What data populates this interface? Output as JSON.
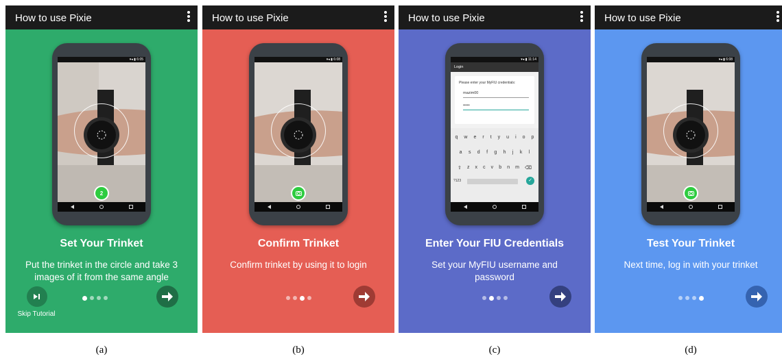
{
  "app_title": "How to use Pixie",
  "panels": [
    {
      "caption": "(a)",
      "bg_color": "#2eab6b",
      "heading": "Set Your Trinket",
      "description": "Put the trinket in the circle and take 3 images of it from the same angle",
      "capture_badge": "2",
      "active_dot": 1,
      "skip_label": "Skip Tutorial",
      "next_color": "#1f6e46"
    },
    {
      "caption": "(b)",
      "bg_color": "#e55e54",
      "heading": "Confirm Trinket",
      "description": "Confirm trinket by using it to login",
      "active_dot": 2,
      "next_color": "#9f3b34"
    },
    {
      "caption": "(c)",
      "bg_color": "#5c6bc8",
      "heading": "Enter Your FIU Credentials",
      "description": "Set your MyFIU username and password",
      "active_dot": 3,
      "next_color": "#34407f",
      "login_screen": {
        "title": "Login",
        "prompt": "Please enter your MyFIU credentials:",
        "username": "mazim00",
        "password_mask": "•••••",
        "keyboard_rows": [
          [
            "q",
            "w",
            "e",
            "r",
            "t",
            "y",
            "u",
            "i",
            "o",
            "p"
          ],
          [
            "a",
            "s",
            "d",
            "f",
            "g",
            "h",
            "j",
            "k",
            "l"
          ],
          [
            "z",
            "x",
            "c",
            "v",
            "b",
            "n",
            "m"
          ]
        ],
        "symbols_key": "?123"
      }
    },
    {
      "caption": "(d)",
      "bg_color": "#5c97f0",
      "heading": "Test Your Trinket",
      "description": "Next time, log in with your trinket",
      "active_dot": 4,
      "next_color": "#3563b0"
    }
  ]
}
